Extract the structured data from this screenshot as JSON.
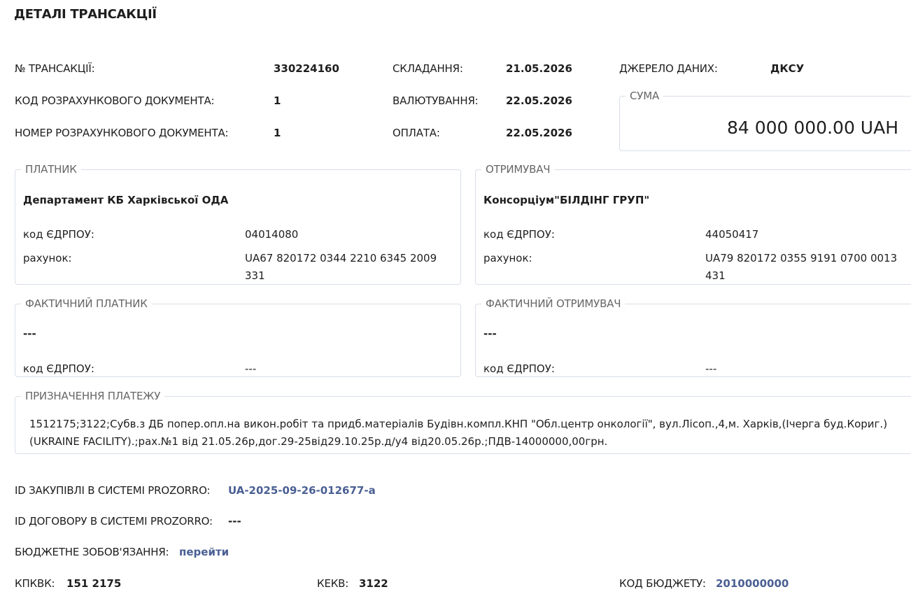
{
  "header": {
    "title": "ДЕТАЛІ ТРАНСАКЦІЇ"
  },
  "info": {
    "transaction_no_label": "№ ТРАНСАКЦІЇ:",
    "transaction_no": "330224160",
    "doc_code_label": "КОД РОЗРАХУНКОВОГО ДОКУМЕНТА:",
    "doc_code": "1",
    "doc_number_label": "НОМЕР РОЗРАХУНКОВОГО ДОКУМЕНТА:",
    "doc_number": "1",
    "compiled_label": "СКЛАДАННЯ:",
    "compiled_date": "21.05.2026",
    "value_date_label": "ВАЛЮТУВАННЯ:",
    "value_date": "22.05.2026",
    "payment_label": "ОПЛАТА:",
    "payment_date": "22.05.2026",
    "source_label": "ДЖЕРЕЛО ДАНИХ:",
    "source": "ДКСУ"
  },
  "amount": {
    "legend": "СУМА",
    "value": "84 000 000.00 UAH"
  },
  "payer": {
    "legend": "ПЛАТНИК",
    "name": "Департамент КБ Харківської ОДА",
    "edrpou_label": "код ЄДРПОУ:",
    "edrpou": "04014080",
    "account_label": "рахунок:",
    "account": "UA67 820172 0344 2210 6345 2009 331"
  },
  "recipient": {
    "legend": "ОТРИМУВАЧ",
    "name": "Консорціум\"БІЛДІНГ ГРУП\"",
    "edrpou_label": "код ЄДРПОУ:",
    "edrpou": "44050417",
    "account_label": "рахунок:",
    "account": "UA79 820172 0355 9191 0700 0013 431"
  },
  "actual_payer": {
    "legend": "ФАКТИЧНИЙ ПЛАТНИК",
    "name": "---",
    "edrpou_label": "код ЄДРПОУ:",
    "edrpou": "---"
  },
  "actual_recipient": {
    "legend": "ФАКТИЧНИЙ ОТРИМУВАЧ",
    "name": "---",
    "edrpou_label": "код ЄДРПОУ:",
    "edrpou": "---"
  },
  "purpose": {
    "legend": "ПРИЗНАЧЕННЯ ПЛАТЕЖУ",
    "text": "1512175;3122;Субв.з ДБ попер.опл.на викон.робіт та придб.матеріалів Будівн.компл.КНП \"Обл.центр онкології\", вул.Лісоп.,4,м. Харків,(Ічерга буд.Кориг.)(UKRAINE FACILITY).;рах.№1 від 21.05.26р,дог.29-25від29.10.25р.д/у4 від20.05.26р.;ПДВ-14000000,00грн."
  },
  "footer": {
    "prozorro_purchase_label": "ID ЗАКУПІВЛІ В СИСТЕМІ PROZORRO:",
    "prozorro_purchase": "UA-2025-09-26-012677-a",
    "prozorro_contract_label": "ID ДОГОВОРУ В СИСТЕМІ PROZORRO:",
    "prozorro_contract": "---",
    "budget_obligation_label": "БЮДЖЕТНЕ ЗОБОВ'ЯЗАННЯ:",
    "budget_obligation_link": "перейти",
    "kpkvk_label": "КПКВК:",
    "kpkvk": "151 2175",
    "kekv_label": "КЕКВ:",
    "kekv": "3122",
    "budget_code_label": "КОД БЮДЖЕТУ:",
    "budget_code": "2010000000"
  }
}
